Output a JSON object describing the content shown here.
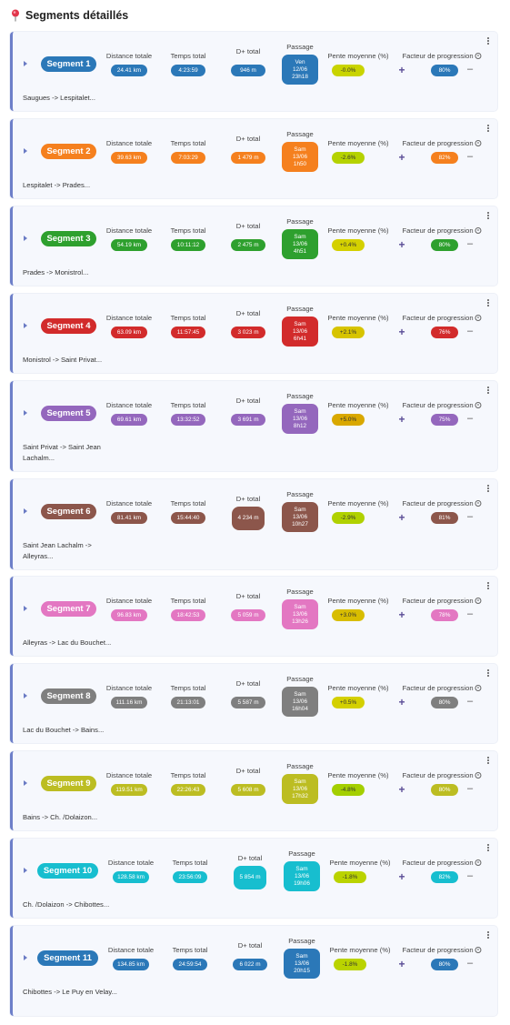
{
  "header": {
    "title": "Segments détaillés",
    "icon": "map-pin-icon"
  },
  "labels": {
    "distance": "Distance totale",
    "time": "Temps total",
    "elevation": "D+ total",
    "passage": "Passage",
    "slope": "Pente moyenne (%)",
    "factor": "Facteur de progression",
    "plus": "+",
    "minus": "–"
  },
  "segments": [
    {
      "name": "Segment 1",
      "color": "#2b78b8",
      "distance": "24.41 km",
      "time": "4:23:59",
      "elevation": "946 m",
      "passage_day": "Ven",
      "passage_date": "12/06",
      "passage_time": "23h18",
      "slope": "-0.0%",
      "slope_color": "#c9d400",
      "factor": "80%",
      "route": "Saugues -> Lespitalet..."
    },
    {
      "name": "Segment 2",
      "color": "#f5801e",
      "distance": "39.63 km",
      "time": "7:03:29",
      "elevation": "1 479 m",
      "passage_day": "Sam",
      "passage_date": "13/06",
      "passage_time": "1h50",
      "slope": "-2.6%",
      "slope_color": "#b5d200",
      "factor": "82%",
      "route": "Lespitalet -> Prades..."
    },
    {
      "name": "Segment 3",
      "color": "#2ea02e",
      "distance": "54.19 km",
      "time": "10:11:12",
      "elevation": "2 475 m",
      "passage_day": "Sam",
      "passage_date": "13/06",
      "passage_time": "4h51",
      "slope": "+0.4%",
      "slope_color": "#d4d000",
      "factor": "80%",
      "route": "Prades -> Monistrol..."
    },
    {
      "name": "Segment 4",
      "color": "#d22b2b",
      "distance": "63.09 km",
      "time": "11:57:45",
      "elevation": "3 023 m",
      "passage_day": "Sam",
      "passage_date": "13/06",
      "passage_time": "6h41",
      "slope": "+2.1%",
      "slope_color": "#d7c400",
      "factor": "76%",
      "route": "Monistrol -> Saint Privat..."
    },
    {
      "name": "Segment 5",
      "color": "#9467bd",
      "distance": "69.61 km",
      "time": "13:32:52",
      "elevation": "3 691 m",
      "passage_day": "Sam",
      "passage_date": "13/06",
      "passage_time": "8h12",
      "slope": "+5.0%",
      "slope_color": "#d9a800",
      "factor": "75%",
      "route": "Saint Privat -> Saint Jean Lachalm..."
    },
    {
      "name": "Segment 6",
      "color": "#8c564b",
      "distance": "81.41 km",
      "time": "15:44:40",
      "elevation": "4 234 m",
      "passage_day": "Sam",
      "passage_date": "13/06",
      "passage_time": "10h27",
      "slope": "-2.9%",
      "slope_color": "#b0d100",
      "factor": "81%",
      "route": "Saint Jean Lachalm -> Alleyras..."
    },
    {
      "name": "Segment 7",
      "color": "#e377c2",
      "distance": "96.83 km",
      "time": "18:42:53",
      "elevation": "5 059 m",
      "passage_day": "Sam",
      "passage_date": "13/06",
      "passage_time": "13h26",
      "slope": "+3.0%",
      "slope_color": "#d8bd00",
      "factor": "78%",
      "route": "Alleyras -> Lac du Bouchet..."
    },
    {
      "name": "Segment 8",
      "color": "#7f7f7f",
      "distance": "111.16 km",
      "time": "21:13:01",
      "elevation": "5 587 m",
      "passage_day": "Sam",
      "passage_date": "13/06",
      "passage_time": "16h04",
      "slope": "+0.5%",
      "slope_color": "#d4d000",
      "factor": "80%",
      "route": "Lac du Bouchet -> Bains..."
    },
    {
      "name": "Segment 9",
      "color": "#bcbd22",
      "distance": "119.51 km",
      "time": "22:26:43",
      "elevation": "5 608 m",
      "passage_day": "Sam",
      "passage_date": "13/06",
      "passage_time": "17h32",
      "slope": "-4.8%",
      "slope_color": "#a4cf00",
      "factor": "80%",
      "route": "Bains -> Ch. /Dolaizon..."
    },
    {
      "name": "Segment 10",
      "color": "#17becf",
      "distance": "128.58 km",
      "time": "23:56:09",
      "elevation": "5 854 m",
      "passage_day": "Sam",
      "passage_date": "13/06",
      "passage_time": "19h06",
      "slope": "-1.8%",
      "slope_color": "#bad300",
      "factor": "82%",
      "route": "Ch. /Dolaizon -> Chibottes..."
    },
    {
      "name": "Segment 11",
      "color": "#2b78b8",
      "distance": "134.85 km",
      "time": "24:59:54",
      "elevation": "6 022 m",
      "passage_day": "Sam",
      "passage_date": "13/06",
      "passage_time": "20h15",
      "slope": "-1.8%",
      "slope_color": "#bad300",
      "factor": "80%",
      "route": "Chibottes -> Le Puy en Velay..."
    }
  ]
}
